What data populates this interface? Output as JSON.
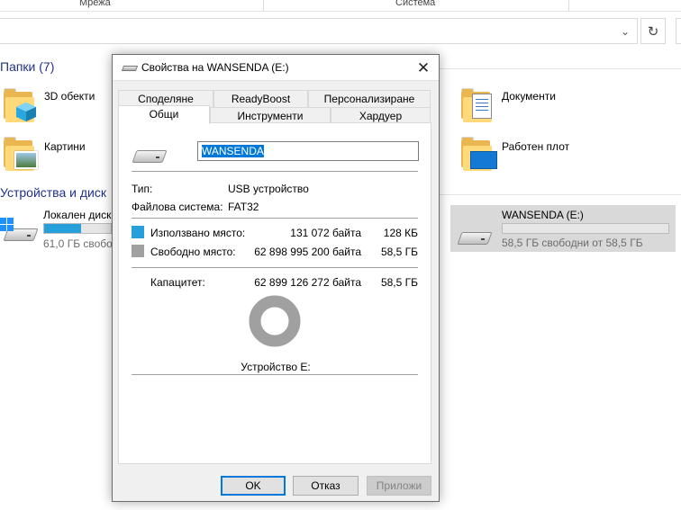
{
  "explorer": {
    "ribbon_groups": [
      "Мрежа",
      "Система"
    ],
    "address_chevron": "⌄",
    "refresh_glyph": "↻",
    "folders_heading": "Папки (7)",
    "folders": [
      {
        "label": "3D обекти"
      },
      {
        "label": "Документи"
      },
      {
        "label": "Картини"
      },
      {
        "label": "Работен плот"
      }
    ],
    "devices_heading": "Устройства и диск",
    "drives": [
      {
        "name": "Локален диск",
        "free_text": "61,0 ГБ свобо",
        "used_fraction": 0.55
      },
      {
        "name": "WANSENDA (E:)",
        "free_text": "58,5 ГБ свободни от 58,5 ГБ",
        "used_fraction": 0.0
      }
    ]
  },
  "dialog": {
    "title": "Свойства на WANSENDA (E:)",
    "close_glyph": "✕",
    "tabs_row1": [
      "Споделяне",
      "ReadyBoost",
      "Персонализиране"
    ],
    "tabs_row2": [
      "Общи",
      "Инструменти",
      "Хардуер"
    ],
    "active_tab": "Общи",
    "drive_name": "WANSENDA",
    "type_label": "Тип:",
    "type_value": "USB устройство",
    "fs_label": "Файлова система:",
    "fs_value": "FAT32",
    "used_label": "Използвано място:",
    "used_bytes": "131 072 байта",
    "used_size": "128 КБ",
    "free_label": "Свободно място:",
    "free_bytes": "62 898 995 200 байта",
    "free_size": "58,5 ГБ",
    "capacity_label": "Капацитет:",
    "capacity_bytes": "62 899 126 272 байта",
    "capacity_size": "58,5 ГБ",
    "used_fraction": 2e-06,
    "device_label": "Устройство E:",
    "buttons": {
      "ok": "OK",
      "cancel": "Отказ",
      "apply": "Приложи"
    },
    "colors": {
      "used": "#26a0da",
      "free": "#a0a0a0"
    }
  }
}
